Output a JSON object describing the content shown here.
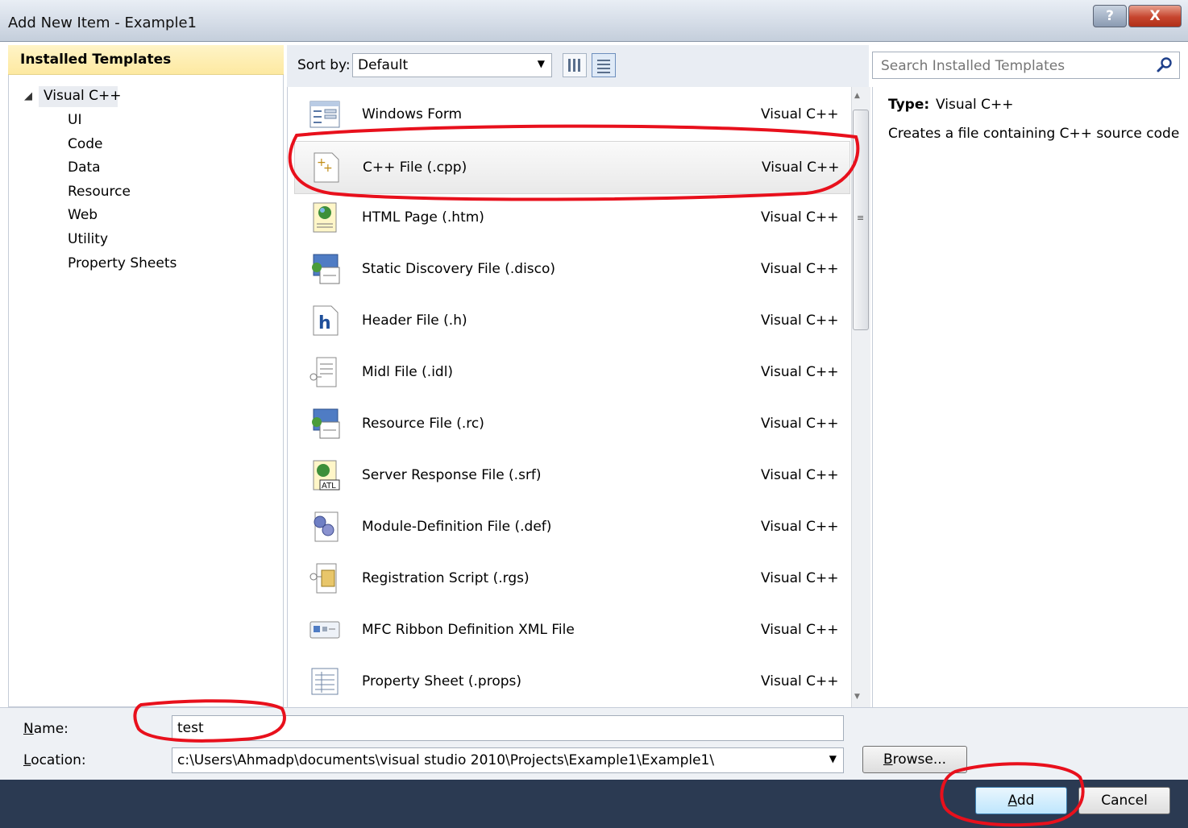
{
  "window": {
    "title": "Add New Item - Example1",
    "help_glyph": "?",
    "close_glyph": "X"
  },
  "left_panel": {
    "header": "Installed Templates",
    "tree": {
      "root": "Visual C++",
      "children": [
        "UI",
        "Code",
        "Data",
        "Resource",
        "Web",
        "Utility",
        "Property Sheets"
      ]
    }
  },
  "toolbar": {
    "sort_label": "Sort by:",
    "sort_value": "Default"
  },
  "search": {
    "placeholder": "Search Installed Templates"
  },
  "templates": [
    {
      "name": "Windows Form",
      "category": "Visual C++",
      "icon": "windows-form-icon"
    },
    {
      "name": "C++ File (.cpp)",
      "category": "Visual C++",
      "icon": "cpp-file-icon",
      "selected": true
    },
    {
      "name": "HTML Page (.htm)",
      "category": "Visual C++",
      "icon": "html-page-icon"
    },
    {
      "name": "Static Discovery File (.disco)",
      "category": "Visual C++",
      "icon": "disco-file-icon"
    },
    {
      "name": "Header File (.h)",
      "category": "Visual C++",
      "icon": "header-file-icon"
    },
    {
      "name": "Midl File (.idl)",
      "category": "Visual C++",
      "icon": "midl-file-icon"
    },
    {
      "name": "Resource File (.rc)",
      "category": "Visual C++",
      "icon": "resource-file-icon"
    },
    {
      "name": "Server Response File (.srf)",
      "category": "Visual C++",
      "icon": "srf-file-icon"
    },
    {
      "name": "Module-Definition File (.def)",
      "category": "Visual C++",
      "icon": "def-file-icon"
    },
    {
      "name": "Registration Script (.rgs)",
      "category": "Visual C++",
      "icon": "rgs-file-icon"
    },
    {
      "name": "MFC Ribbon Definition XML File",
      "category": "Visual C++",
      "icon": "ribbon-xml-icon"
    },
    {
      "name": "Property Sheet (.props)",
      "category": "Visual C++",
      "icon": "property-sheet-icon"
    }
  ],
  "details": {
    "type_label": "Type:",
    "type_value": "Visual C++",
    "description": "Creates a file containing C++ source code"
  },
  "form": {
    "name_label_prefix": "N",
    "name_label_rest": "ame:",
    "name_value": "test",
    "location_label_prefix": "L",
    "location_label_rest": "ocation:",
    "location_value": "c:\\Users\\Ahmadp\\documents\\visual studio 2010\\Projects\\Example1\\Example1\\"
  },
  "buttons": {
    "browse_prefix": "B",
    "browse_rest": "rowse...",
    "add_prefix": "A",
    "add_rest": "dd",
    "cancel": "Cancel"
  },
  "colors": {
    "accent": "#2b3a52",
    "annotation": "#e8101c",
    "selection_header": "#fde9a1"
  }
}
